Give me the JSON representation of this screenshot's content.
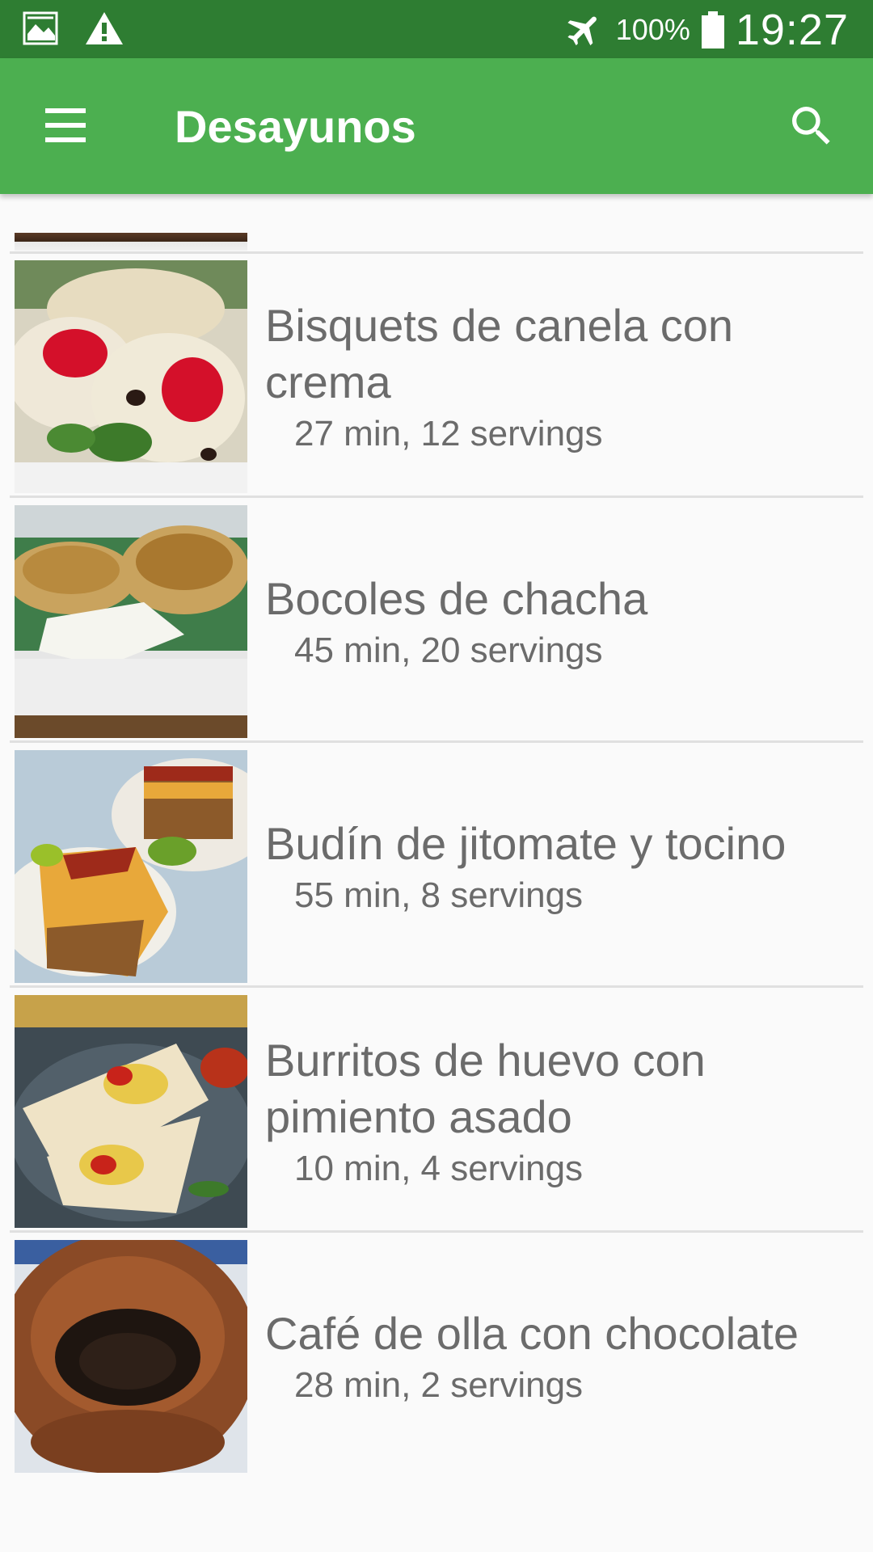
{
  "status_bar": {
    "battery_percent": "100%",
    "time": "19:27",
    "icons": [
      "image-icon",
      "warning-icon",
      "airplane-icon",
      "battery-icon"
    ]
  },
  "app_bar": {
    "title": "Desayunos",
    "icons": [
      "menu-icon",
      "search-icon"
    ],
    "color": "#4caf50"
  },
  "recipes": [
    {
      "title": "Bisquets de canela con crema",
      "subtitle": "27 min, 12 servings"
    },
    {
      "title": "Bocoles de chacha",
      "subtitle": "45 min, 20 servings"
    },
    {
      "title": "Budín de jitomate y tocino",
      "subtitle": "55 min, 8 servings"
    },
    {
      "title": "Burritos de huevo con pimiento asado",
      "subtitle": "10 min, 4 servings"
    },
    {
      "title": "Café de olla con chocolate",
      "subtitle": "28 min, 2 servings"
    }
  ]
}
